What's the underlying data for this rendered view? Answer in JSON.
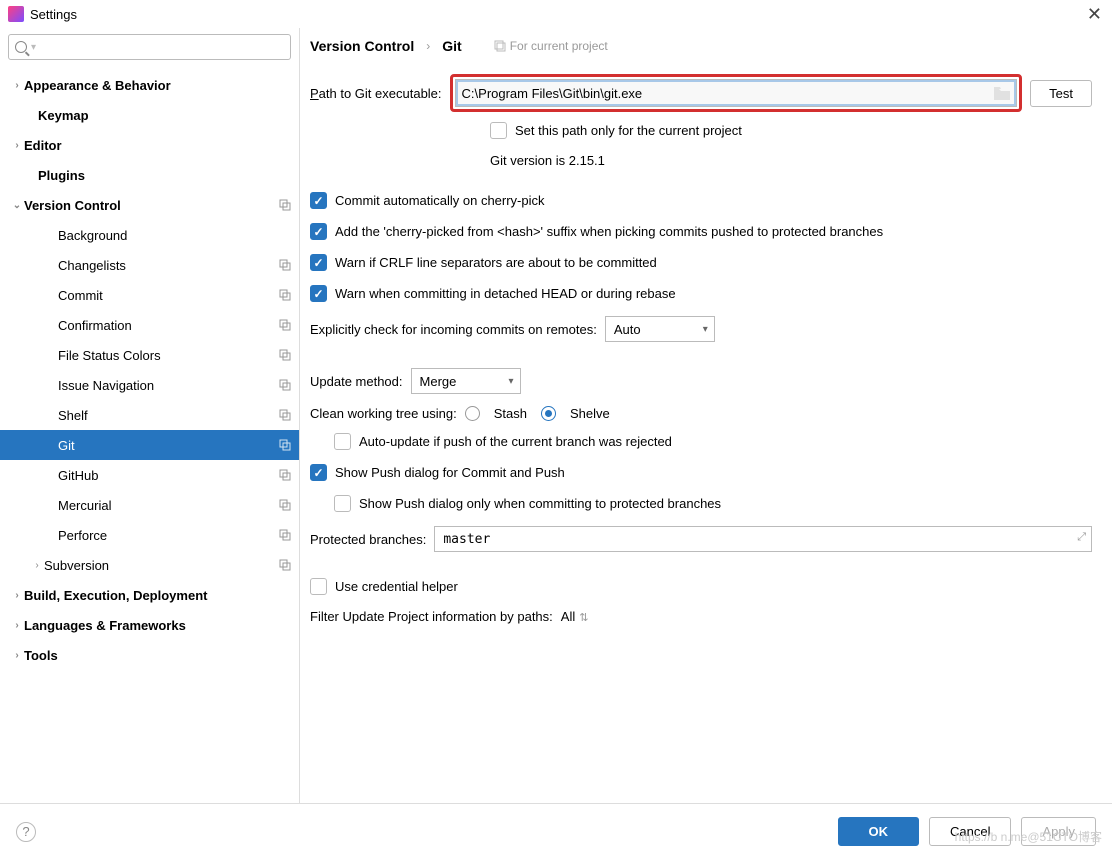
{
  "window": {
    "title": "Settings"
  },
  "search": {
    "placeholder": ""
  },
  "sidebar": {
    "items": [
      {
        "label": "Appearance & Behavior",
        "arrow": ">",
        "bold": true,
        "indent": 10,
        "copy": false
      },
      {
        "label": "Keymap",
        "arrow": "",
        "bold": true,
        "indent": 24,
        "copy": false
      },
      {
        "label": "Editor",
        "arrow": ">",
        "bold": true,
        "indent": 10,
        "copy": false
      },
      {
        "label": "Plugins",
        "arrow": "",
        "bold": true,
        "indent": 24,
        "copy": false
      },
      {
        "label": "Version Control",
        "arrow": "v",
        "bold": true,
        "indent": 10,
        "copy": true
      },
      {
        "label": "Background",
        "arrow": "",
        "bold": false,
        "indent": 44,
        "copy": false
      },
      {
        "label": "Changelists",
        "arrow": "",
        "bold": false,
        "indent": 44,
        "copy": true
      },
      {
        "label": "Commit",
        "arrow": "",
        "bold": false,
        "indent": 44,
        "copy": true
      },
      {
        "label": "Confirmation",
        "arrow": "",
        "bold": false,
        "indent": 44,
        "copy": true
      },
      {
        "label": "File Status Colors",
        "arrow": "",
        "bold": false,
        "indent": 44,
        "copy": true
      },
      {
        "label": "Issue Navigation",
        "arrow": "",
        "bold": false,
        "indent": 44,
        "copy": true
      },
      {
        "label": "Shelf",
        "arrow": "",
        "bold": false,
        "indent": 44,
        "copy": true
      },
      {
        "label": "Git",
        "arrow": "",
        "bold": false,
        "indent": 44,
        "copy": true,
        "selected": true
      },
      {
        "label": "GitHub",
        "arrow": "",
        "bold": false,
        "indent": 44,
        "copy": true
      },
      {
        "label": "Mercurial",
        "arrow": "",
        "bold": false,
        "indent": 44,
        "copy": true
      },
      {
        "label": "Perforce",
        "arrow": "",
        "bold": false,
        "indent": 44,
        "copy": true
      },
      {
        "label": "Subversion",
        "arrow": ">",
        "bold": false,
        "indent": 30,
        "copy": true
      },
      {
        "label": "Build, Execution, Deployment",
        "arrow": ">",
        "bold": true,
        "indent": 10,
        "copy": false
      },
      {
        "label": "Languages & Frameworks",
        "arrow": ">",
        "bold": true,
        "indent": 10,
        "copy": false
      },
      {
        "label": "Tools",
        "arrow": ">",
        "bold": true,
        "indent": 10,
        "copy": false
      }
    ]
  },
  "breadcrumb": {
    "root": "Version Control",
    "page": "Git",
    "hint": "For current project"
  },
  "git": {
    "path_label": "Path to Git executable:",
    "path_value": "C:\\Program Files\\Git\\bin\\git.exe",
    "test_btn": "Test",
    "set_only_current": "Set this path only for the current project",
    "version_line": "Git version is 2.15.1",
    "opt_cherry_auto": "Commit automatically on cherry-pick",
    "opt_cherry_suffix": "Add the 'cherry-picked from <hash>' suffix when picking commits pushed to protected branches",
    "opt_warn_crlf": "Warn if CRLF line separators are about to be committed",
    "opt_warn_detached": "Warn when committing in detached HEAD or during rebase",
    "explicit_check_label": "Explicitly check for incoming commits on remotes:",
    "explicit_check_value": "Auto",
    "update_method_label": "Update method:",
    "update_method_value": "Merge",
    "clean_tree_label": "Clean working tree using:",
    "clean_stash": "Stash",
    "clean_shelve": "Shelve",
    "opt_auto_update": "Auto-update if push of the current branch was rejected",
    "opt_show_push": "Show Push dialog for Commit and Push",
    "opt_show_push_protected": "Show Push dialog only when committing to protected branches",
    "protected_label": "Protected branches:",
    "protected_value": "master",
    "use_credential": "Use credential helper",
    "filter_label": "Filter Update Project information by paths:",
    "filter_value": "All"
  },
  "footer": {
    "ok": "OK",
    "cancel": "Cancel",
    "apply": "Apply"
  }
}
